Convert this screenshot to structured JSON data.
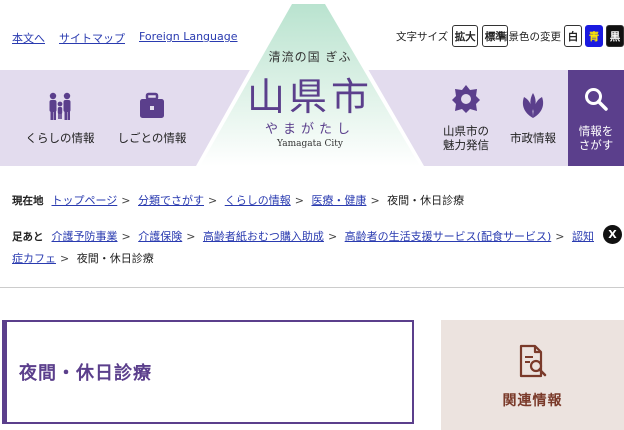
{
  "util_links": [
    "本文へ",
    "サイトマップ",
    "Foreign Language"
  ],
  "textsize": {
    "label": "文字サイズ",
    "large": "拡大",
    "standard": "標準"
  },
  "bgcolor": {
    "label": "背景色の変更",
    "white": "白",
    "blue": "青",
    "black": "黒"
  },
  "nav": {
    "life": "くらしの情報",
    "work": "しごとの情報",
    "charm": "山県市の\n魅力発信",
    "admin": "市政情報",
    "search": "情報を\nさがす"
  },
  "logo": {
    "tagline": "清流の国 ぎふ",
    "main": "山県市",
    "kana": "やまがたし",
    "en": "Yamagata City"
  },
  "breadcrumb_current": {
    "label": "現在地",
    "items": [
      "トップページ",
      "分類でさがす",
      "くらしの情報",
      "医療・健康"
    ],
    "current": "夜間・休日診療"
  },
  "breadcrumb_history": {
    "label": "足あと",
    "items": [
      "介護予防事業",
      "介護保険",
      "高齢者紙おむつ購入助成",
      "高齢者の生活支援サービス(配食サービス)",
      "認知症カフェ"
    ],
    "current": "夜間・休日診療",
    "close": "X"
  },
  "page_title": "夜間・休日診療",
  "related_label": "関連情報",
  "colors": {
    "accent": "#5b3f8c",
    "nav_bg": "#e3dcee",
    "link": "#2a3bb0",
    "related_bg": "#ece3df"
  }
}
